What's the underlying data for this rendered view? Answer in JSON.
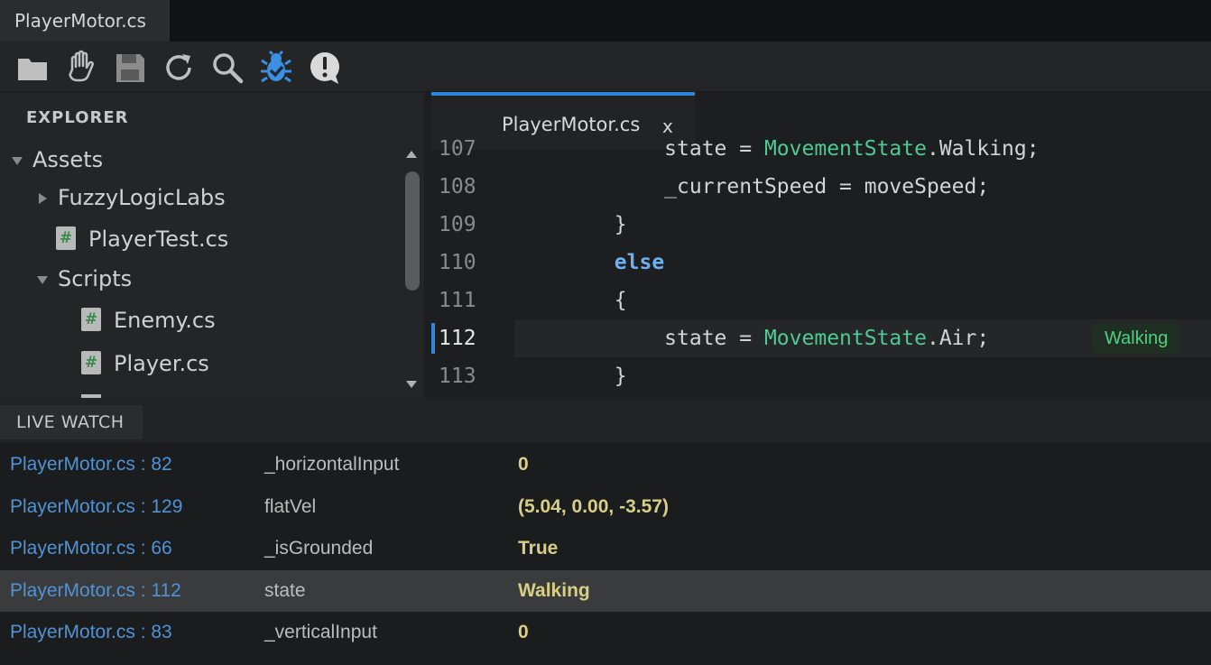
{
  "window": {
    "title": "PlayerMotor.cs"
  },
  "toolbar": {
    "buttons": [
      {
        "name": "open-folder",
        "icon": "folder-icon"
      },
      {
        "name": "hand-tool",
        "icon": "hand-icon"
      },
      {
        "name": "save",
        "icon": "save-icon"
      },
      {
        "name": "reload",
        "icon": "refresh-icon"
      },
      {
        "name": "search",
        "icon": "search-icon"
      },
      {
        "name": "debug",
        "icon": "bug-icon",
        "active": true,
        "color": "#3d8fe0"
      },
      {
        "name": "alerts",
        "icon": "alert-icon"
      }
    ]
  },
  "explorer": {
    "title": "EXPLORER",
    "items": [
      {
        "label": "Assets",
        "type": "folder",
        "expanded": true,
        "depth": 0
      },
      {
        "label": "FuzzyLogicLabs",
        "type": "folder",
        "expanded": false,
        "depth": 1
      },
      {
        "label": "PlayerTest.cs",
        "type": "file",
        "depth": 1
      },
      {
        "label": "Scripts",
        "type": "folder",
        "expanded": true,
        "depth": 1
      },
      {
        "label": "Enemy.cs",
        "type": "file",
        "depth": 2
      },
      {
        "label": "Player.cs",
        "type": "file",
        "depth": 2
      }
    ],
    "file_icon_glyph": "#"
  },
  "editor": {
    "tab": {
      "label": "PlayerMotor.cs",
      "close": "x"
    },
    "current_line": "112",
    "lines": [
      {
        "no": "107",
        "parts": [
          {
            "t": "            state = ",
            "c": ""
          },
          {
            "t": "MovementState",
            "c": "type"
          },
          {
            "t": ".Walking;",
            "c": ""
          }
        ]
      },
      {
        "no": "108",
        "parts": [
          {
            "t": "            _currentSpeed = moveSpeed;",
            "c": ""
          }
        ]
      },
      {
        "no": "109",
        "parts": [
          {
            "t": "        }",
            "c": ""
          }
        ]
      },
      {
        "no": "110",
        "parts": [
          {
            "t": "        ",
            "c": ""
          },
          {
            "t": "else",
            "c": "kw"
          }
        ]
      },
      {
        "no": "111",
        "parts": [
          {
            "t": "        {",
            "c": ""
          }
        ]
      },
      {
        "no": "112",
        "parts": [
          {
            "t": "            state = ",
            "c": ""
          },
          {
            "t": "MovementState",
            "c": "type"
          },
          {
            "t": ".Air;",
            "c": ""
          }
        ]
      },
      {
        "no": "113",
        "parts": [
          {
            "t": "        }",
            "c": ""
          }
        ]
      }
    ],
    "inline_value": "Walking"
  },
  "watch": {
    "title": "LIVE WATCH",
    "rows": [
      {
        "location": "PlayerMotor.cs : 82",
        "name": "_horizontalInput",
        "value": "0",
        "selected": false
      },
      {
        "location": "PlayerMotor.cs : 129",
        "name": "flatVel",
        "value": "(5.04, 0.00, -3.57)",
        "selected": false
      },
      {
        "location": "PlayerMotor.cs : 66",
        "name": "_isGrounded",
        "value": "True",
        "selected": false
      },
      {
        "location": "PlayerMotor.cs : 112",
        "name": "state",
        "value": "Walking",
        "selected": true
      },
      {
        "location": "PlayerMotor.cs : 83",
        "name": "_verticalInput",
        "value": "0",
        "selected": false
      }
    ]
  },
  "colors": {
    "accent": "#2f86d8",
    "keyword": "#6fb1f0",
    "type": "#4fc996",
    "watch_value": "#d7cf86",
    "watch_location": "#4f93d6"
  }
}
